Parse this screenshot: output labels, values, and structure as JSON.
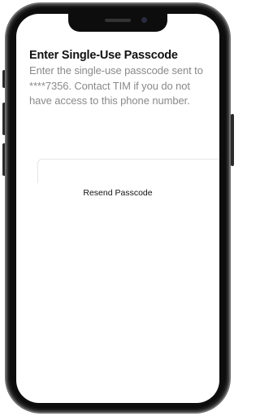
{
  "screen": {
    "title": "Enter Single-Use Passcode",
    "description": "Enter the single-use passcode sent to ****7356. Contact TIM if you do not have access to this phone number.",
    "passcode_input": {
      "value": "",
      "placeholder": ""
    },
    "resend_label": "Resend Passcode"
  },
  "colors": {
    "title": "#111111",
    "description": "#8a8a8a",
    "phone_frame": "#1b1b1b",
    "screen_background": "#ffffff"
  }
}
